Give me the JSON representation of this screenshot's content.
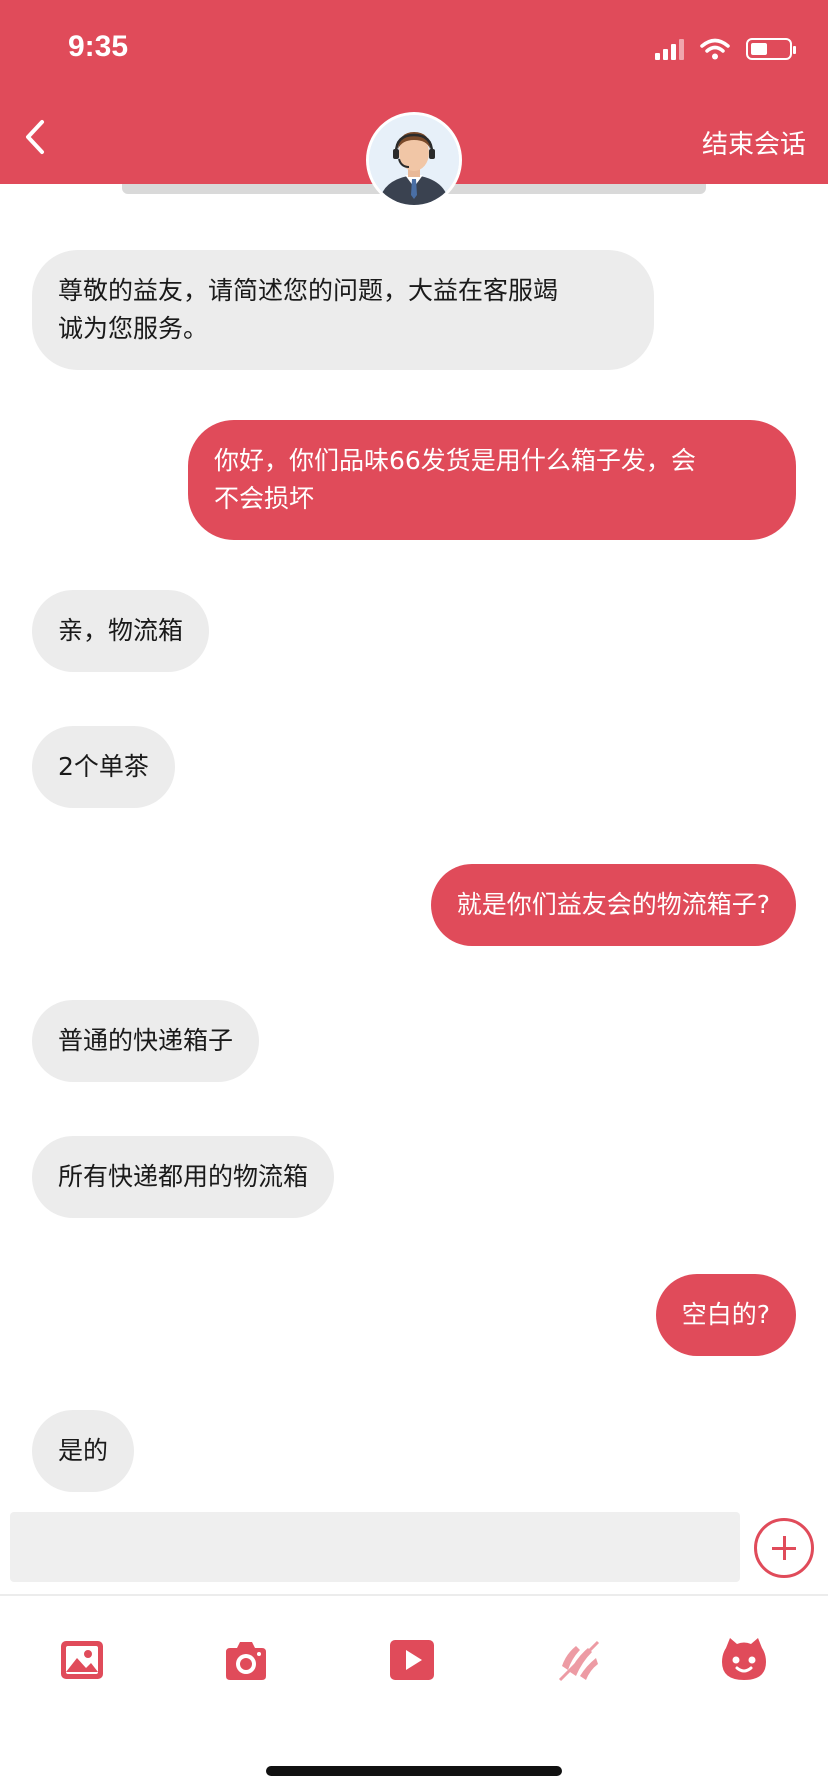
{
  "status_bar": {
    "time": "9:35",
    "battery_level": 0.45
  },
  "header": {
    "back_icon": "chevron-left-icon",
    "end_session_label": "结束会话",
    "avatar_icon": "customer-service-agent-avatar"
  },
  "messages": [
    {
      "from": "agent",
      "lines": [
        "尊敬的益友，请简述您的问题，大益在客服竭",
        "诚为您服务。"
      ]
    },
    {
      "from": "user",
      "lines": [
        "你好，你们品味66发货是用什么箱子发，会",
        "不会损坏"
      ]
    },
    {
      "from": "agent",
      "lines": [
        "亲，物流箱"
      ]
    },
    {
      "from": "agent",
      "lines": [
        "2个单茶"
      ]
    },
    {
      "from": "user",
      "lines": [
        "就是你们益友会的物流箱子?"
      ]
    },
    {
      "from": "agent",
      "lines": [
        "普通的快递箱子"
      ]
    },
    {
      "from": "agent",
      "lines": [
        "所有快递都用的物流箱"
      ]
    },
    {
      "from": "user",
      "lines": [
        "空白的?"
      ]
    },
    {
      "from": "agent",
      "lines": [
        "是的"
      ]
    }
  ],
  "input": {
    "value": "",
    "placeholder": ""
  },
  "toolbar": {
    "icons": [
      "image-icon",
      "camera-icon",
      "video-icon",
      "voice-off-icon",
      "emoji-icon"
    ]
  },
  "colors": {
    "accent": "#e04b5a",
    "incoming_bubble": "#ececec",
    "text": "#1a1a1a"
  }
}
